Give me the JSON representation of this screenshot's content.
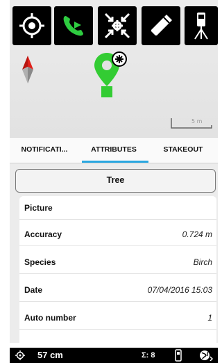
{
  "toolbar": {
    "buttons": [
      {
        "icon": "crosshair-target-icon"
      },
      {
        "icon": "phone-play-icon"
      },
      {
        "icon": "zoom-to-center-icon"
      },
      {
        "icon": "pencil-edit-icon"
      },
      {
        "icon": "gnss-receiver-tripod-icon"
      }
    ]
  },
  "map": {
    "scale_label": "5 m",
    "marker_icon": "point-feature-marker-icon",
    "north_icon": "north-arrow-icon"
  },
  "tabs": {
    "items": [
      {
        "label": "NOTIFICATI..."
      },
      {
        "label": "ATTRIBUTES"
      },
      {
        "label": "STAKEOUT"
      }
    ],
    "active_index": 1,
    "accent_color": "#2aa7e0"
  },
  "attributes": {
    "feature_type": "Tree",
    "rows": [
      {
        "label": "Picture",
        "value": ""
      },
      {
        "label": "Accuracy",
        "value": "0.724 m"
      },
      {
        "label": "Species",
        "value": "Birch"
      },
      {
        "label": "Date",
        "value": "07/04/2016 15:03"
      },
      {
        "label": "Auto number",
        "value": "1"
      }
    ]
  },
  "status_bar": {
    "accuracy": "57 cm",
    "satellites": "Σ: 8",
    "icons": [
      "gps-icon",
      "receiver-icon",
      "globe-icon"
    ]
  },
  "colors": {
    "marker_green": "#33cc33",
    "call_green": "#2ecc40",
    "north_red": "#e0201a"
  }
}
